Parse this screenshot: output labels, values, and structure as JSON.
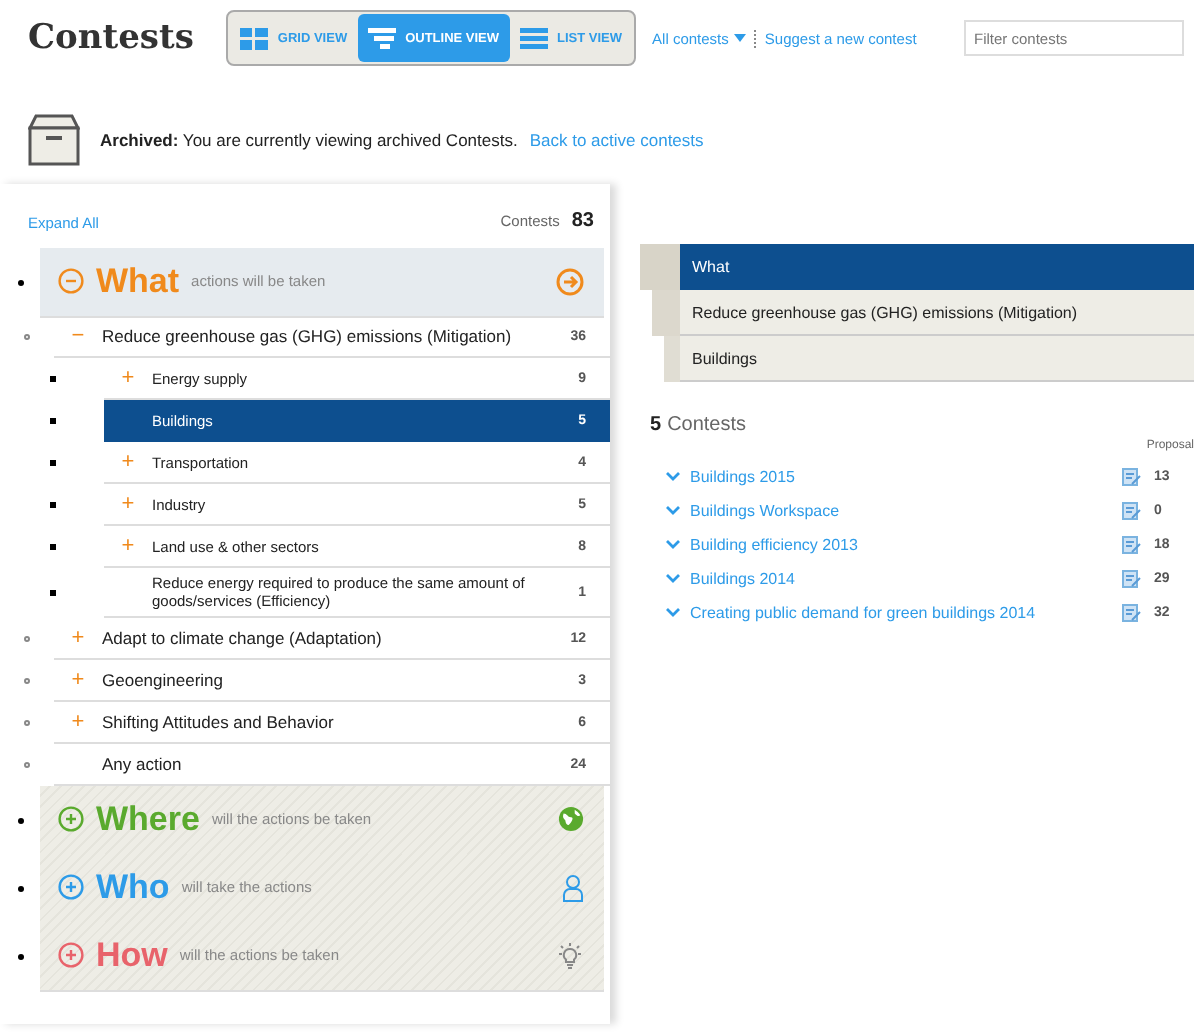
{
  "header": {
    "title": "Contests",
    "views": [
      {
        "label": "GRID VIEW",
        "kind": "grid",
        "selected": false
      },
      {
        "label": "OUTLINE VIEW",
        "kind": "outline",
        "selected": true
      },
      {
        "label": "LIST VIEW",
        "kind": "list",
        "selected": false
      }
    ],
    "filter_menu": "All contests",
    "suggest_link": "Suggest a new contest",
    "filter_field": {
      "placeholder": "Filter contests"
    }
  },
  "notice": {
    "text": "**Archived:** You are currently viewing archived Contests.",
    "link": "Back to active contests"
  },
  "outline": {
    "expand_all": "Expand All",
    "count_label": "Contests",
    "count": "83",
    "sections": [
      {
        "kind": "what",
        "title": "What",
        "subtitle": "actions will be taken",
        "color": "#f08a1c",
        "expanded": true,
        "items": [
          {
            "label": "Reduce greenhouse gas (GHG) emissions (Mitigation)",
            "count": "36",
            "toggle": "−",
            "selected": false,
            "children": [
              {
                "label": "Energy supply",
                "count": "9",
                "toggle": "+",
                "selected": false
              },
              {
                "label": "Buildings",
                "count": "5",
                "selected": true
              },
              {
                "label": "Transportation",
                "count": "4",
                "toggle": "+",
                "selected": false
              },
              {
                "label": "Industry",
                "count": "5",
                "toggle": "+",
                "selected": false
              },
              {
                "label": "Land use & other sectors",
                "count": "8",
                "toggle": "+",
                "selected": false
              },
              {
                "label": "Reduce energy required to produce the same amount of goods/services (Efficiency)",
                "count": "1",
                "selected": false
              }
            ]
          },
          {
            "label": "Adapt to climate change (Adaptation)",
            "count": "12",
            "toggle": "+",
            "selected": false
          },
          {
            "label": "Geoengineering",
            "count": "3",
            "toggle": "+",
            "selected": false
          },
          {
            "label": "Shifting Attitudes and Behavior",
            "count": "6",
            "toggle": "+",
            "selected": false
          },
          {
            "label": "Any action",
            "count": "24",
            "selected": false
          }
        ]
      },
      {
        "kind": "where",
        "title": "Where",
        "subtitle": "will the actions be taken",
        "color": "#5aaa2e",
        "expanded": false
      },
      {
        "kind": "who",
        "title": "Who",
        "subtitle": "will take the actions",
        "color": "#2d9be8",
        "expanded": false
      },
      {
        "kind": "how",
        "title": "How",
        "subtitle": "will the actions be taken",
        "color": "#e8636b",
        "expanded": false
      }
    ]
  },
  "breadcrumb": [
    {
      "label": "What",
      "highlighted": true
    },
    {
      "label": "Reduce greenhouse gas (GHG) emissions (Mitigation)",
      "highlighted": false
    },
    {
      "label": "Buildings",
      "highlighted": false
    }
  ],
  "results": {
    "count": "5",
    "label": "Contests",
    "proposals_header": "Proposal",
    "contests": [
      {
        "title": "Buildings 2015",
        "proposals": "13"
      },
      {
        "title": "Buildings Workspace",
        "proposals": "0"
      },
      {
        "title": "Building efficiency 2013",
        "proposals": "18"
      },
      {
        "title": "Buildings 2014",
        "proposals": "29"
      },
      {
        "title": "Creating public demand for green buildings 2014",
        "proposals": "32"
      }
    ]
  }
}
